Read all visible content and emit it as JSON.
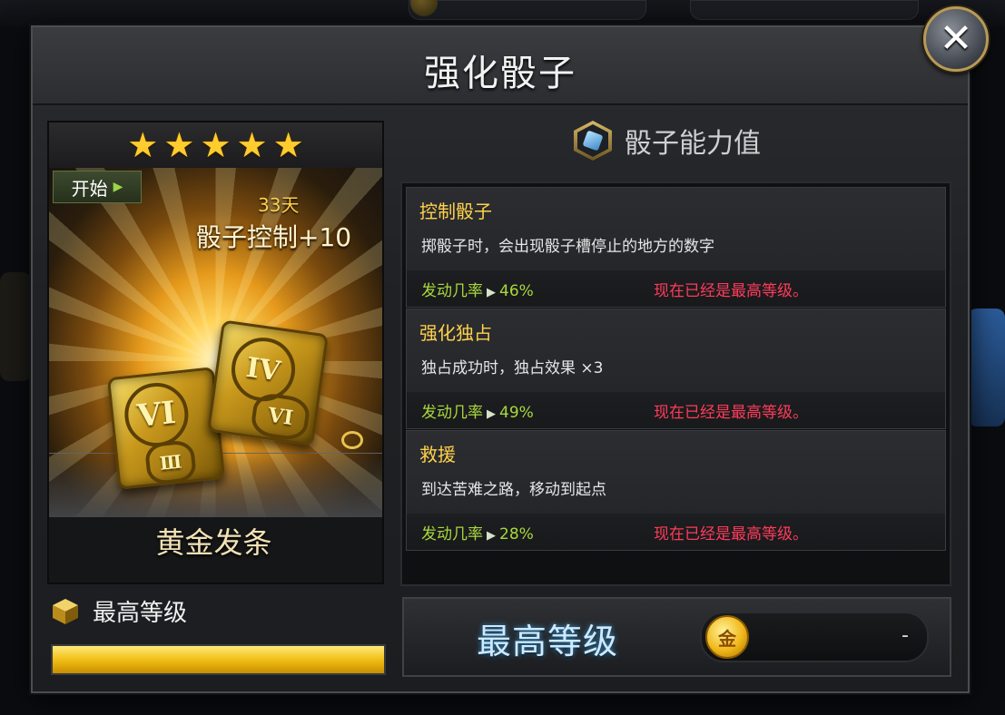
{
  "dialog": {
    "title": "强化骰子",
    "close_icon": "close-icon"
  },
  "item": {
    "stars": 5,
    "start_label": "开始",
    "duration": "33天",
    "skill": "骰子控制+10",
    "name": "黄金发条"
  },
  "level": {
    "label": "最高等级",
    "progress": 1.0
  },
  "abilities_header": "骰子能力值",
  "abilities": [
    {
      "name": "控制骰子",
      "desc": "掷骰子时，会出现骰子槽停止的地方的数字",
      "rate_label": "发动几率",
      "rate": "46%",
      "status": "现在已经是最高等级。"
    },
    {
      "name": "强化独占",
      "desc": "独占成功时，独占效果 ×3",
      "rate_label": "发动几率",
      "rate": "49%",
      "status": "现在已经是最高等级。"
    },
    {
      "name": "救援",
      "desc": "到达苦难之路，移动到起点",
      "rate_label": "发动几率",
      "rate": "28%",
      "status": "现在已经是最高等级。"
    }
  ],
  "upgrade": {
    "label": "最高等级",
    "coin_glyph": "金",
    "cost": "-"
  },
  "colors": {
    "gold": "#ffd24a",
    "rate_green": "#a8d83c",
    "max_red": "#ff3b5a"
  }
}
